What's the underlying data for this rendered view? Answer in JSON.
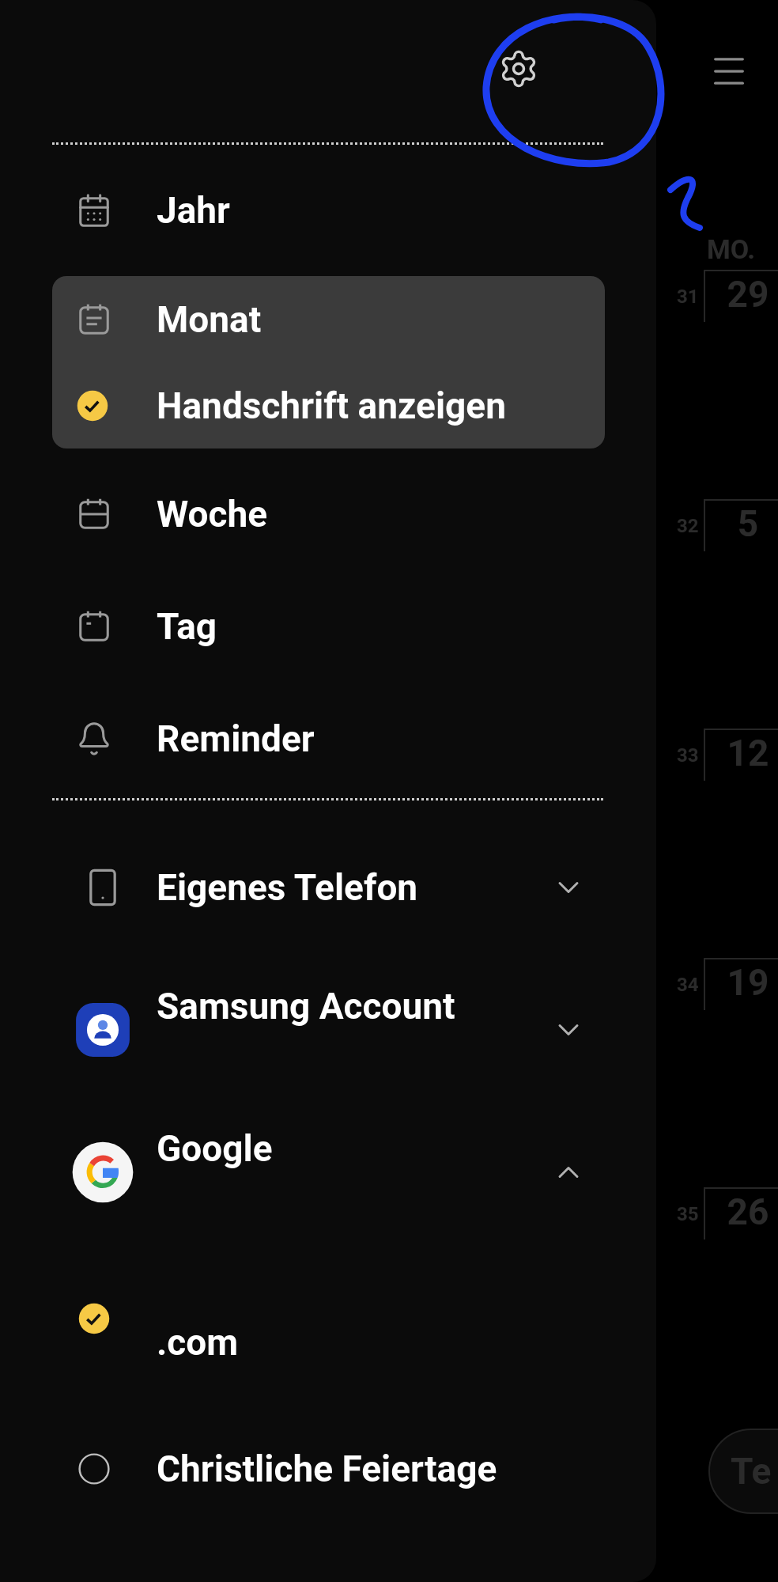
{
  "views": [
    {
      "label": "Jahr",
      "kind": "year",
      "selected": false
    },
    {
      "label": "Monat",
      "kind": "month",
      "selected": true,
      "option": {
        "label": "Handschrift anzeigen",
        "checked": true
      }
    },
    {
      "label": "Woche",
      "kind": "week",
      "selected": false
    },
    {
      "label": "Tag",
      "kind": "day",
      "selected": false
    },
    {
      "label": "Reminder",
      "kind": "reminder",
      "selected": false
    }
  ],
  "accounts": [
    {
      "name": "Eigenes Telefon",
      "kind": "phone",
      "expanded": false
    },
    {
      "name": "Samsung Account",
      "kind": "samsung",
      "expanded": false
    },
    {
      "name": "Google",
      "kind": "google",
      "expanded": true,
      "calendars": [
        {
          "name": ".com",
          "checked": true
        },
        {
          "name": "Christliche Feiertage",
          "checked": false
        }
      ]
    }
  ],
  "calendar": {
    "weekday": "MO.",
    "weeks": [
      {
        "number": "31",
        "date": "29"
      },
      {
        "number": "32",
        "date": "5"
      },
      {
        "number": "33",
        "date": "12"
      },
      {
        "number": "34",
        "date": "19"
      },
      {
        "number": "35",
        "date": "26"
      }
    ],
    "today_button": "Te"
  }
}
